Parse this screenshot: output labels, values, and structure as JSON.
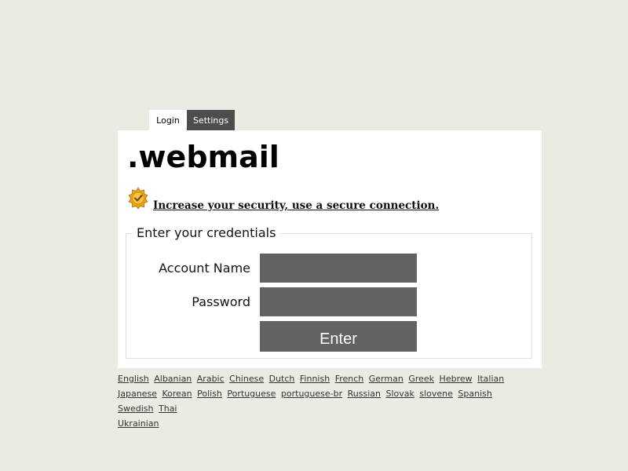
{
  "tabs": [
    {
      "label": "Login",
      "active": true
    },
    {
      "label": "Settings",
      "active": false
    }
  ],
  "brand": ".webmail",
  "security": {
    "icon": "certificate-seal-icon",
    "link_text": "Increase your security, use a secure connection."
  },
  "credentials": {
    "legend": "Enter your credentials",
    "account_label": "Account Name",
    "account_value": "",
    "password_label": "Password",
    "password_value": "",
    "enter_label": "Enter"
  },
  "languages": [
    "English",
    "Albanian",
    "Arabic",
    "Chinese",
    "Dutch",
    "Finnish",
    "French",
    "German",
    "Greek",
    "Hebrew",
    "Italian",
    "Japanese",
    "Korean",
    "Polish",
    "Portuguese",
    "portuguese-br",
    "Russian",
    "Slovak",
    "slovene",
    "Spanish",
    "Swedish",
    "Thai",
    "Ukrainian"
  ],
  "colors": {
    "background": "#ebebe4",
    "panel": "#ffffff",
    "tab_inactive": "#4d4d4d",
    "input_fill": "#626262",
    "seal_gold": "#e8a317"
  }
}
